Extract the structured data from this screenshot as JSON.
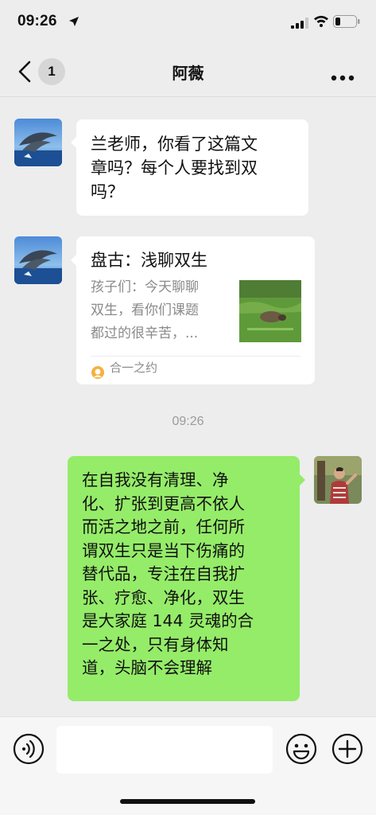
{
  "status_bar": {
    "time": "09:26",
    "location_icon": "location-arrow-icon",
    "signal_icon": "cellular-signal-icon",
    "wifi_icon": "wifi-icon",
    "battery_icon": "battery-icon"
  },
  "nav": {
    "back_icon": "chevron-left-icon",
    "unread_count": "1",
    "title": "阿薇",
    "more_icon": "more-dots-icon"
  },
  "messages": [
    {
      "direction": "incoming",
      "avatar": "dolphin-avatar",
      "type": "text",
      "text": "兰老师，你看了这篇文\n章吗？每个人要找到双\n吗？"
    },
    {
      "direction": "incoming",
      "avatar": "dolphin-avatar",
      "type": "link_card",
      "title": "盘古：浅聊双生",
      "description": "孩子们：今天聊聊\n双生，看你们课题\n都过的很辛苦，...",
      "thumbnail": "animal-on-grass-thumbnail",
      "source": "合一之约",
      "source_icon": "official-account-icon"
    }
  ],
  "timestamp": "09:26",
  "outgoing": {
    "avatar": "person-avatar",
    "text": "在自我没有清理、净\n化、扩张到更高不依人\n而活之地之前，任何所\n谓双生只是当下伤痛的\n替代品，专注在自我扩\n张、疗愈、净化，双生\n是大家庭 144 灵魂的合\n一之处，只有身体知\n道，头脑不会理解"
  },
  "input_bar": {
    "voice_icon": "voice-icon",
    "input_value": "",
    "emoji_icon": "emoji-icon",
    "plus_icon": "plus-icon"
  },
  "colors": {
    "background": "#ededed",
    "incoming_bubble": "#ffffff",
    "outgoing_bubble": "#95ec69",
    "muted_text": "#8a8a8a"
  }
}
